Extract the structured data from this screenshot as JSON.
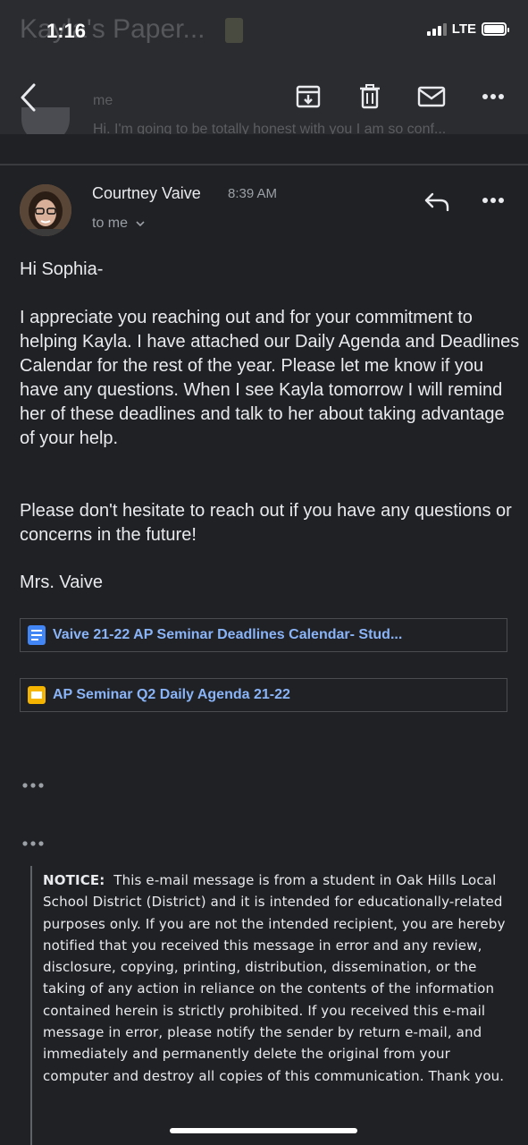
{
  "status_bar": {
    "time": "1:16",
    "network": "LTE"
  },
  "header": {
    "ghost_subject": "Kayla's Paper...",
    "ghost_sender": "me",
    "ghost_snippet": "Hi. I'm going to be totally honest with you I am so conf..."
  },
  "message": {
    "sender": "Courtney Vaive",
    "time": "8:39 AM",
    "recipient": "to me",
    "greeting": "Hi Sophia-",
    "paragraph1": "I appreciate you reaching out and for your commitment to helping Kayla. I have attached our Daily Agenda and Deadlines Calendar for the rest of the year. Please let me know if you have any questions. When I see Kayla tomorrow I will remind her of these deadlines and talk to her about taking advantage of your help.",
    "paragraph2": "Please don't hesitate to reach out if you have any questions or concerns in the future!",
    "signature": "Mrs. Vaive"
  },
  "attachments": [
    {
      "label": "Vaive 21-22 AP Seminar Deadlines Calendar- Stud...",
      "icon": "google-docs-icon"
    },
    {
      "label": "AP Seminar Q2 Daily Agenda 21-22",
      "icon": "google-slides-icon"
    }
  ],
  "notice": {
    "heading": "NOTICE:",
    "text": "This e-mail message is from a student in Oak Hills Local School District (District) and it is intended for educationally-related purposes only.  If you are not the intended recipient, you are hereby notified that you received this message in error and any review, disclosure, copying, printing, distribution, dissemination, or the taking of any action in reliance on the contents of the information contained herein is strictly prohibited.  If you received this e-mail message in error, please notify the sender by return e-mail, and immediately and permanently delete the original from your computer and destroy all copies of this communication.  Thank you."
  },
  "colors": {
    "background": "#202124",
    "link": "#8ab4f8",
    "docs_blue": "#4285f4",
    "slides_yellow": "#f4b400"
  }
}
